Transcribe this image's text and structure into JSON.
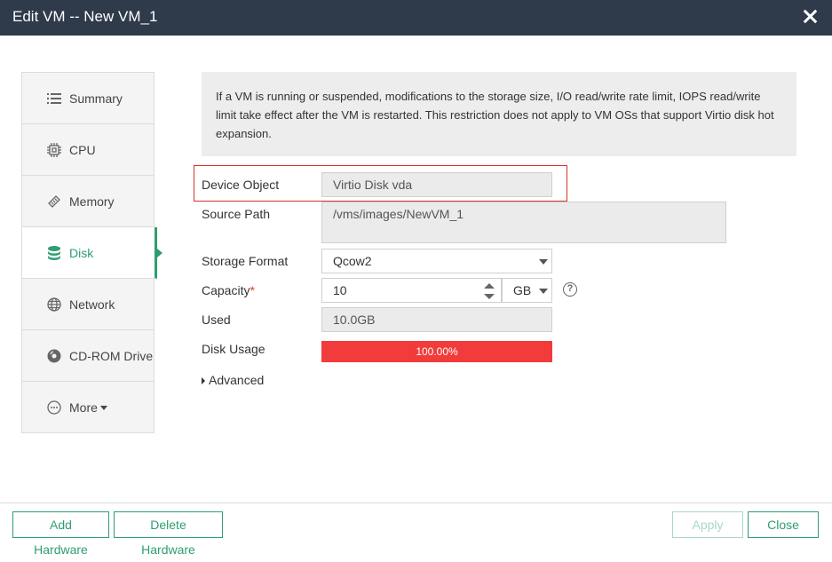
{
  "window": {
    "title": "Edit VM -- New VM_1"
  },
  "sidebar": {
    "items": [
      {
        "label": "Summary",
        "icon": "list-icon"
      },
      {
        "label": "CPU",
        "icon": "cpu-icon"
      },
      {
        "label": "Memory",
        "icon": "memory-icon"
      },
      {
        "label": "Disk",
        "icon": "database-icon",
        "active": true
      },
      {
        "label": "Network",
        "icon": "globe-icon"
      },
      {
        "label": "CD-ROM Drive",
        "icon": "disc-icon"
      },
      {
        "label": "More",
        "icon": "more-icon"
      }
    ]
  },
  "notice": "If a VM is running or suspended, modifications to the storage size, I/O read/write rate limit, IOPS read/write limit take effect after the VM is restarted. This restriction does not apply to VM OSs that support Virtio disk hot expansion.",
  "form": {
    "device_object": {
      "label": "Device Object",
      "value": "Virtio Disk vda"
    },
    "source_path": {
      "label": "Source Path",
      "value": "/vms/images/NewVM_1"
    },
    "storage_format": {
      "label": "Storage Format",
      "value": "Qcow2"
    },
    "capacity": {
      "label": "Capacity",
      "required_mark": "*",
      "value": "10",
      "unit": "GB"
    },
    "used": {
      "label": "Used",
      "value": "10.0GB"
    },
    "disk_usage": {
      "label": "Disk Usage",
      "value_text": "100.00%",
      "fraction": 1.0
    },
    "advanced": {
      "label": "Advanced"
    }
  },
  "footer": {
    "add_hardware": "Add Hardware",
    "delete_hardware": "Delete Hardware",
    "apply": "Apply",
    "close": "Close"
  },
  "colors": {
    "accent": "#2e9e6f",
    "titlebar": "#2f3a4b",
    "usage_bar": "#f23b3b",
    "highlight_border": "#d9322b"
  }
}
